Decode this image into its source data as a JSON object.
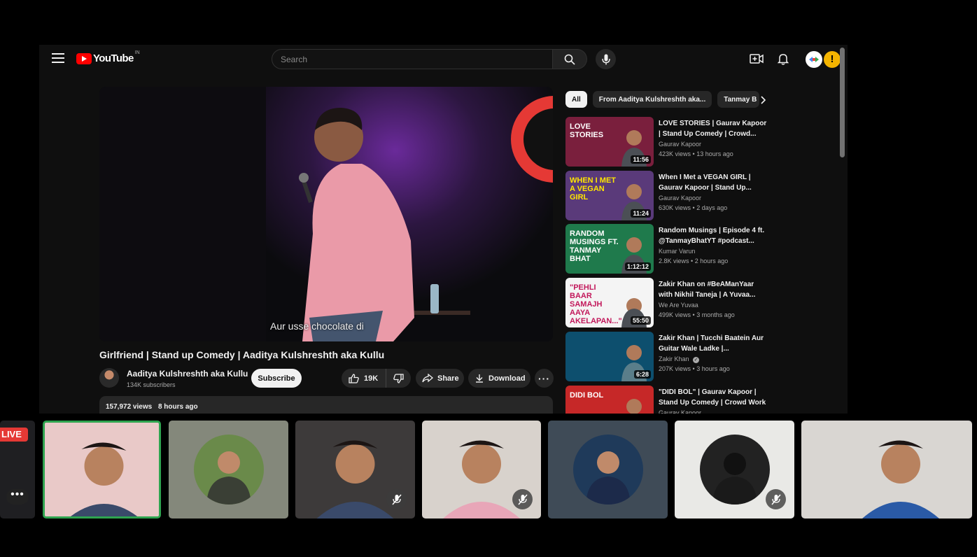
{
  "youtube": {
    "logo_text": "YouTube",
    "country_code": "IN",
    "search": {
      "placeholder": "Search"
    },
    "video": {
      "caption": "Aur usse chocolate di",
      "title": "Girlfriend | Stand up Comedy | Aaditya Kulshreshth aka Kullu",
      "channel_name": "Aaditya Kulshreshth aka Kullu",
      "subscribers": "134K subscribers",
      "subscribe_label": "Subscribe",
      "likes": "19K",
      "share_label": "Share",
      "download_label": "Download",
      "views": "157,972 views",
      "posted": "8 hours ago"
    },
    "chips": [
      "All",
      "From Aaditya Kulshreshth aka...",
      "Tanmay B"
    ],
    "recommendations": [
      {
        "title": "LOVE STORIES | Gaurav Kapoor | Stand Up Comedy | Crowd...",
        "channel": "Gaurav Kapoor",
        "views": "423K views",
        "age": "13 hours ago",
        "duration": "11:56",
        "thumb_text": "LOVE STORIES",
        "thumb_bg": "#7a1f3d",
        "thumb_fg": "#ffffff"
      },
      {
        "title": "When I Met a VEGAN GIRL | Gaurav Kapoor | Stand Up...",
        "channel": "Gaurav Kapoor",
        "views": "630K views",
        "age": "2 days ago",
        "duration": "11:24",
        "thumb_text": "WHEN I MET A VEGAN GIRL",
        "thumb_bg": "#5a3a7a",
        "thumb_fg": "#ffe600"
      },
      {
        "title": "Random Musings | Episode 4 ft. @TanmayBhatYT #podcast...",
        "channel": "Kumar Varun",
        "views": "2.8K views",
        "age": "2 hours ago",
        "duration": "1:12:12",
        "thumb_text": "RANDOM MUSINGS FT. TANMAY BHAT",
        "thumb_bg": "#1f7a4c",
        "thumb_fg": "#ffffff"
      },
      {
        "title": "Zakir Khan on #BeAManYaar with Nikhil Taneja | A Yuvaa...",
        "channel": "We Are Yuvaa",
        "views": "499K views",
        "age": "3 months ago",
        "duration": "55:50",
        "thumb_text": "\"PEHLI BAAR SAMAJH AAYA AKELAPAN...\"",
        "thumb_bg": "#f4f4f4",
        "thumb_fg": "#c2185b"
      },
      {
        "title": "Zakir Khan | Tucchi Baatein Aur Guitar Wale Ladke |...",
        "channel": "Zakir Khan",
        "views": "207K views",
        "age": "3 hours ago",
        "duration": "6:28",
        "thumb_text": "",
        "thumb_bg": "#0d4f6e",
        "thumb_fg": "#ffffff"
      },
      {
        "title": "\"DIDI BOL\" | Gaurav Kapoor | Stand Up Comedy | Crowd Work",
        "channel": "Gaurav Kapoor",
        "views": "",
        "age": "",
        "duration": "",
        "thumb_text": "DIDI BOL",
        "thumb_bg": "#c62828",
        "thumb_fg": "#ffffff"
      }
    ]
  },
  "meeting": {
    "live_label": "LIVE",
    "more_label": "•••",
    "participants": [
      {
        "label": "participant-1",
        "type": "video",
        "bg": "#e9c9c8",
        "active": true,
        "muted": false
      },
      {
        "label": "participant-2",
        "type": "avatar",
        "bg": "#84887b",
        "active": false,
        "muted": false
      },
      {
        "label": "participant-3",
        "type": "video",
        "bg": "#3d3a3a",
        "active": false,
        "muted": true
      },
      {
        "label": "participant-4",
        "type": "video",
        "bg": "#d8d2cc",
        "active": false,
        "muted": true
      },
      {
        "label": "participant-5",
        "type": "avatar",
        "bg": "#3f4b57",
        "active": false,
        "muted": false
      },
      {
        "label": "participant-6",
        "type": "avatar",
        "bg": "#e9e9e6",
        "active": false,
        "muted": true
      },
      {
        "label": "participant-7",
        "type": "video",
        "bg": "#d9d6d2",
        "active": false,
        "muted": false
      }
    ]
  }
}
